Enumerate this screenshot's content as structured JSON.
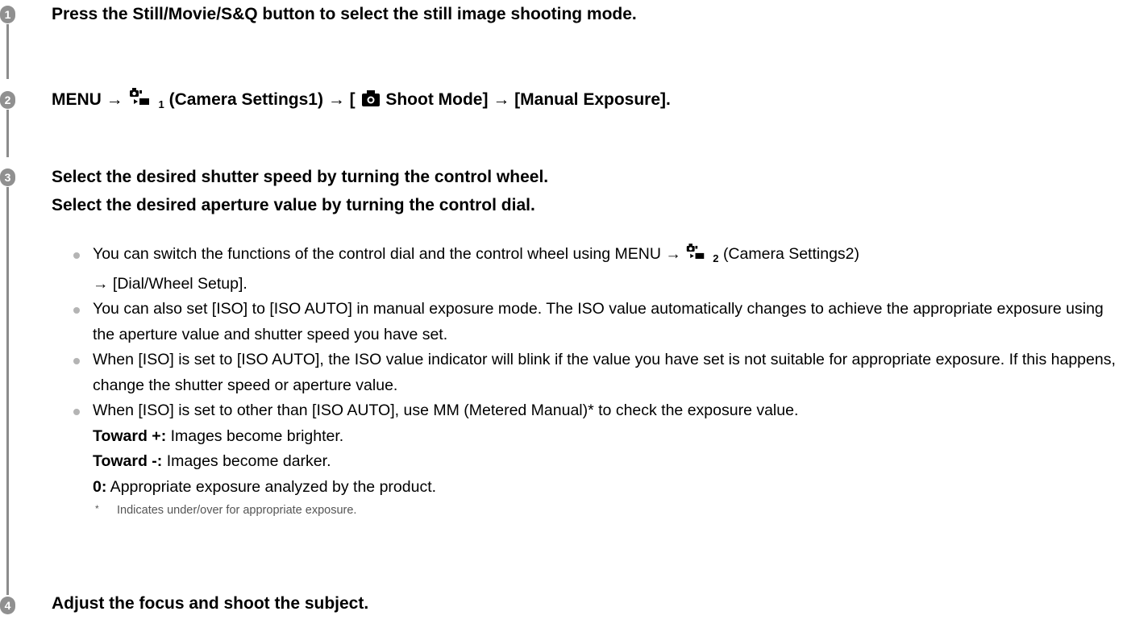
{
  "steps": [
    {
      "number": "1",
      "title": "Press the Still/Movie/S&Q button to select the still image shooting mode."
    },
    {
      "number": "2",
      "menu": "MENU →",
      "settings_icon_sub": "1",
      "settings_text": "(Camera Settings1) → [",
      "mode_text": "Shoot Mode] → [Manual Exposure]."
    },
    {
      "number": "3",
      "title_line1": "Select the desired shutter speed by turning the control wheel.",
      "title_line2": "Select the desired aperture value by turning the control dial.",
      "bullets": {
        "b1_pre": "You can switch the functions of the control dial and the control wheel using MENU →",
        "b1_icon_sub": "2",
        "b1_post": "(Camera Settings2)",
        "b1_line2": "→ [Dial/Wheel Setup].",
        "b2": "You can also set [ISO] to [ISO AUTO] in manual exposure mode. The ISO value automatically changes to achieve the appropriate exposure using the aperture value and shutter speed you have set.",
        "b3": "When [ISO] is set to [ISO AUTO], the ISO value indicator will blink if the value you have set is not suitable for appropriate exposure. If this happens, change the shutter speed or aperture value.",
        "b4": "When [ISO] is set to other than [ISO AUTO], use MM (Metered Manual)* to check the exposure value.",
        "toward_plus_label": "Toward +:",
        "toward_plus_text": " Images become brighter.",
        "toward_minus_label": "Toward -:",
        "toward_minus_text": " Images become darker.",
        "zero_label": "0:",
        "zero_text": " Appropriate exposure analyzed by the product.",
        "note_mark": "*",
        "note_text": "Indicates under/over for appropriate exposure."
      }
    },
    {
      "number": "4",
      "title": "Adjust the focus and shoot the subject."
    }
  ],
  "icons": {
    "camera_settings": "camera-settings-icon",
    "still_camera": "still-camera-icon",
    "bullet_color": "#b4b4b4",
    "step_badge_color": "#909090"
  }
}
